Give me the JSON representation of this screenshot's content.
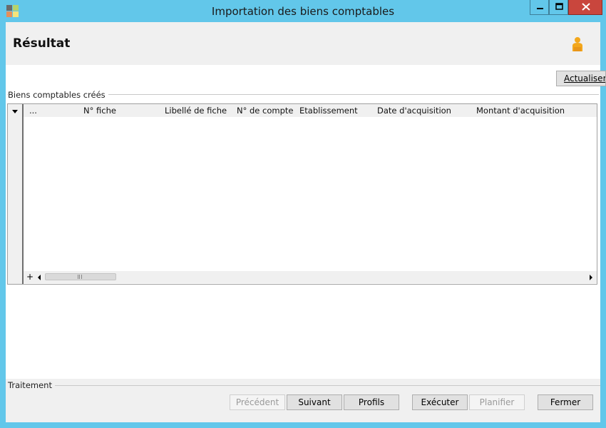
{
  "window": {
    "title": "Importation des biens comptables",
    "controls": [
      "minimize-icon",
      "maximize-icon",
      "close-icon"
    ]
  },
  "header": {
    "title": "Résultat",
    "icon": "person-icon"
  },
  "actions": {
    "refresh_label": "Actualiser"
  },
  "group": {
    "label": "Biens comptables créés"
  },
  "grid": {
    "columns": [
      "...",
      "N° fiche",
      "Libellé de fiche",
      "N° de compte",
      "Etablissement",
      "Date d'acquisition",
      "Montant d'acquisition"
    ],
    "rows": [],
    "add_symbol": "+"
  },
  "footer": {
    "label": "Traitement",
    "buttons": {
      "previous": "Précédent",
      "next": "Suivant",
      "profiles": "Profils",
      "execute": "Exécuter",
      "schedule": "Planifier",
      "close": "Fermer"
    }
  },
  "colors": {
    "window_frame": "#62c7ea",
    "close_button": "#c9463d",
    "panel_bg": "#f0f0f0"
  }
}
